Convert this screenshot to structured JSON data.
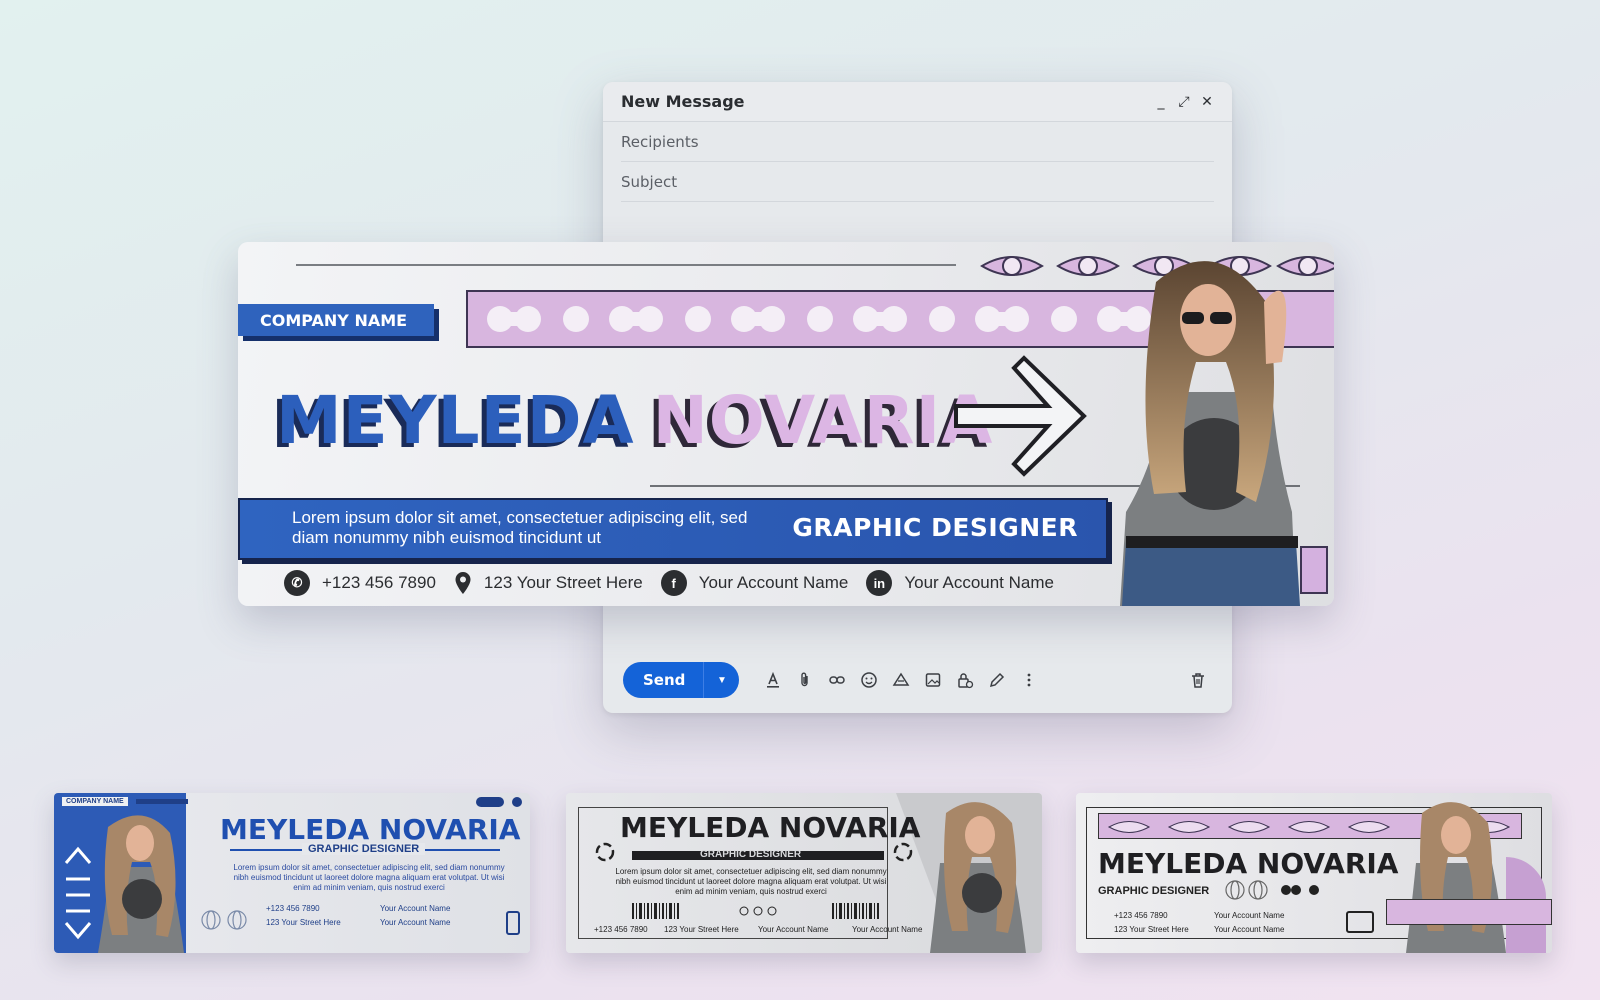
{
  "compose": {
    "title": "New Message",
    "minimize_glyph": "_",
    "expand_glyph": "⤢",
    "close_glyph": "✕",
    "recipients_placeholder": "Recipients",
    "subject_placeholder": "Subject",
    "send_label": "Send",
    "toolbar_icons": [
      "format-text-icon",
      "attach-icon",
      "link-icon",
      "emoji-icon",
      "drive-icon",
      "image-icon",
      "confidential-lock-icon",
      "signature-pen-icon",
      "more-options-icon"
    ],
    "trash_icon": "trash-icon"
  },
  "signature": {
    "company": "COMPANY NAME",
    "first_name": "MEYLEDA",
    "last_name": "NOVARIA",
    "description_line1": "Lorem ipsum dolor sit amet, consectetuer adipiscing elit, sed",
    "description_line2": "diam nonummy nibh euismod tincidunt ut",
    "role": "GRAPHIC DESIGNER",
    "phone": "+123 456 7890",
    "address": "123 Your Street Here",
    "facebook": "Your Account Name",
    "linkedin": "Your Account Name",
    "accent_blue": "#2f63bd",
    "accent_lilac": "#d8b6df"
  },
  "thumbnails": [
    {
      "company": "COMPANY NAME",
      "name": "MEYLEDA NOVARIA",
      "role": "GRAPHIC DESIGNER",
      "desc1": "Lorem ipsum dolor sit amet, consectetuer adipiscing elit, sed diam nonummy",
      "desc2": "nibh euismod tincidunt ut laoreet dolore magna aliquam erat volutpat. Ut wisi",
      "desc3": "enim ad minim veniam, quis nostrud exerci",
      "phone": "+123 456 7890",
      "address": "123 Your Street Here",
      "facebook": "Your Account Name",
      "linkedin": "Your Account Name"
    },
    {
      "name": "MEYLEDA NOVARIA",
      "role": "GRAPHIC DESIGNER",
      "desc1": "Lorem ipsum dolor sit amet, consectetuer adipiscing elit, sed diam nonummy",
      "desc2": "nibh euismod tincidunt ut laoreet dolore magna aliquam erat volutpat. Ut wisi",
      "desc3": "enim ad minim veniam, quis nostrud exerci",
      "phone": "+123 456 7890",
      "address": "123 Your Street Here",
      "facebook": "Your Account Name",
      "linkedin": "Your Account Name"
    },
    {
      "name": "MEYLEDA NOVARIA",
      "role": "GRAPHIC DESIGNER",
      "phone": "+123 456 7890",
      "address": "123 Your Street Here",
      "facebook": "Your Account Name",
      "linkedin": "Your Account Name"
    }
  ]
}
